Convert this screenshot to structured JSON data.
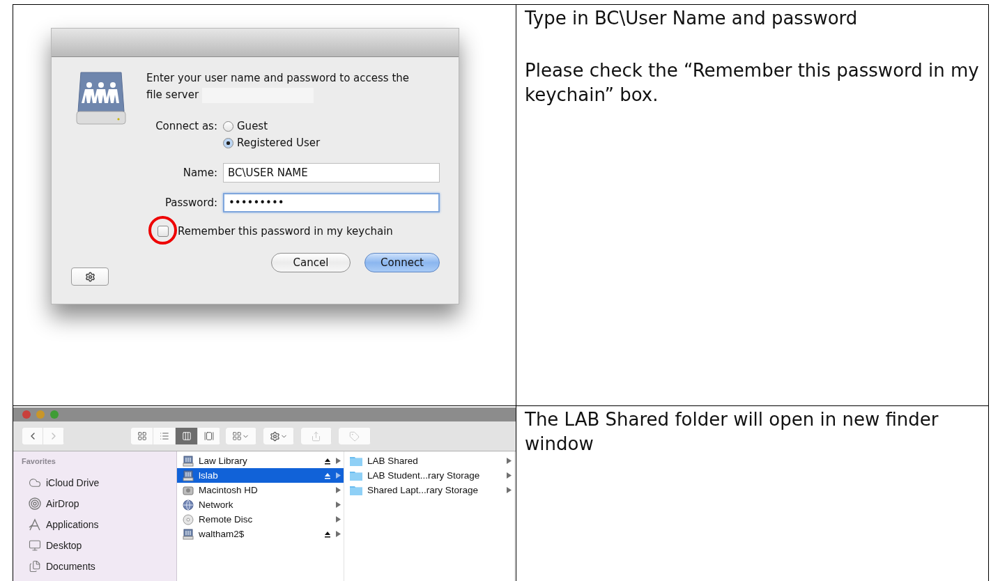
{
  "login_step": {
    "dialog": {
      "message": "Enter your user name and password to access the file server",
      "connect_as_label": "Connect as:",
      "connect_options": [
        {
          "label": "Guest",
          "selected": false
        },
        {
          "label": "Registered User",
          "selected": true
        }
      ],
      "fields": [
        {
          "label": "Name:",
          "value": "BC\\USER NAME",
          "focused": false
        },
        {
          "label": "Password:",
          "value": "•••••••••",
          "focused": true
        }
      ],
      "remember_checkbox": {
        "label": "Remember this password in my keychain",
        "checked": false,
        "highlighted": true
      },
      "buttons": [
        {
          "label": "Cancel",
          "default": false
        },
        {
          "label": "Connect",
          "default": true
        }
      ]
    },
    "instructions": [
      "Type in BC\\User Name and password",
      "Please check the “Remember this password in my keychain” box."
    ]
  },
  "finder_step": {
    "finder": {
      "nav_buttons": [
        {
          "kind": "back",
          "disabled": false
        },
        {
          "kind": "forward",
          "disabled": true
        }
      ],
      "view_modes": [
        {
          "kind": "icons",
          "selected": false
        },
        {
          "kind": "list",
          "selected": false
        },
        {
          "kind": "columns",
          "selected": true
        },
        {
          "kind": "coverflow",
          "selected": false
        }
      ],
      "toolbar_buttons": [
        {
          "kind": "arrange"
        },
        {
          "kind": "action"
        },
        {
          "kind": "share"
        },
        {
          "kind": "tags"
        }
      ],
      "sidebar": {
        "heading": "Favorites",
        "items": [
          {
            "label": "iCloud Drive",
            "kind": "cloud"
          },
          {
            "label": "AirDrop",
            "kind": "airdrop"
          },
          {
            "label": "Applications",
            "kind": "apps"
          },
          {
            "label": "Desktop",
            "kind": "desktop"
          },
          {
            "label": "Documents",
            "kind": "documents"
          }
        ]
      },
      "column_1": [
        {
          "label": "Law Library",
          "kind": "server",
          "ejectable": true,
          "selected": false
        },
        {
          "label": "lslab",
          "kind": "server",
          "ejectable": true,
          "selected": true
        },
        {
          "label": "Macintosh HD",
          "kind": "disk",
          "ejectable": false,
          "selected": false
        },
        {
          "label": "Network",
          "kind": "network",
          "ejectable": false,
          "selected": false
        },
        {
          "label": "Remote Disc",
          "kind": "disc",
          "ejectable": false,
          "selected": false
        },
        {
          "label": "waltham2$",
          "kind": "server",
          "ejectable": true,
          "selected": false
        }
      ],
      "column_2": [
        {
          "label": "LAB Shared",
          "selected": false
        },
        {
          "label": "LAB Student...rary Storage",
          "selected": false
        },
        {
          "label": "Shared Lapt...rary Storage",
          "selected": false
        }
      ]
    },
    "instructions": [
      "The LAB Shared folder will open in new finder window"
    ]
  }
}
